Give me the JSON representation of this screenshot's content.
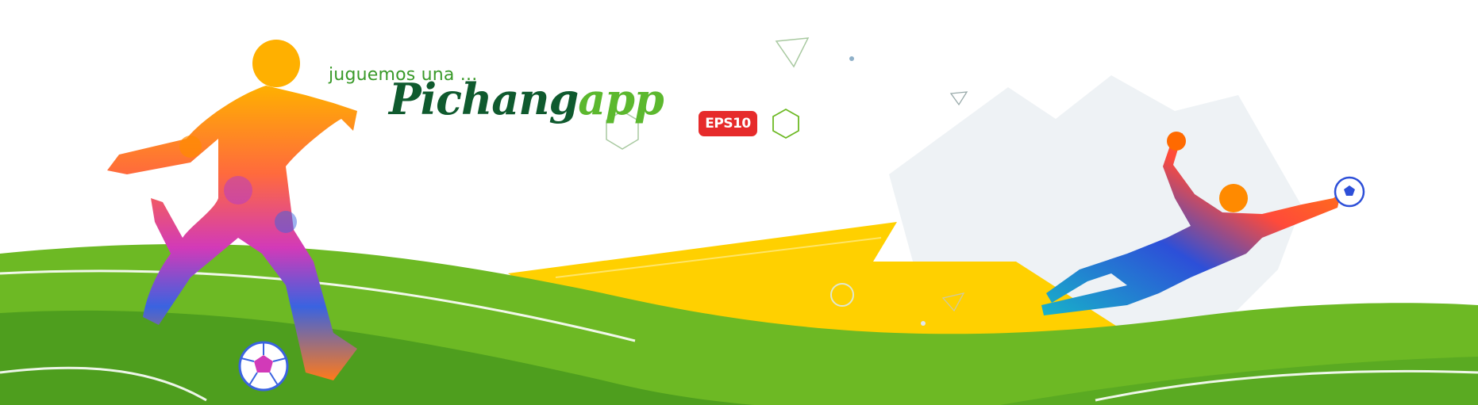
{
  "banner": {
    "tagline": "juguemos una ...",
    "brand_part1": "Pichang",
    "brand_part2": "app",
    "badge": "EPS10"
  },
  "colors": {
    "grass_dark": "#4e9e1e",
    "grass_mid": "#6db924",
    "grass_light": "#86c93a",
    "yellow": "#ffd000",
    "badge_red": "#e62b2b",
    "brand_dark_green": "#0f5a2e",
    "brand_light_green": "#5cb82e"
  },
  "icons": [
    "hexagon-icon",
    "triangle-icon",
    "circle-icon",
    "soccer-ball-icon"
  ]
}
